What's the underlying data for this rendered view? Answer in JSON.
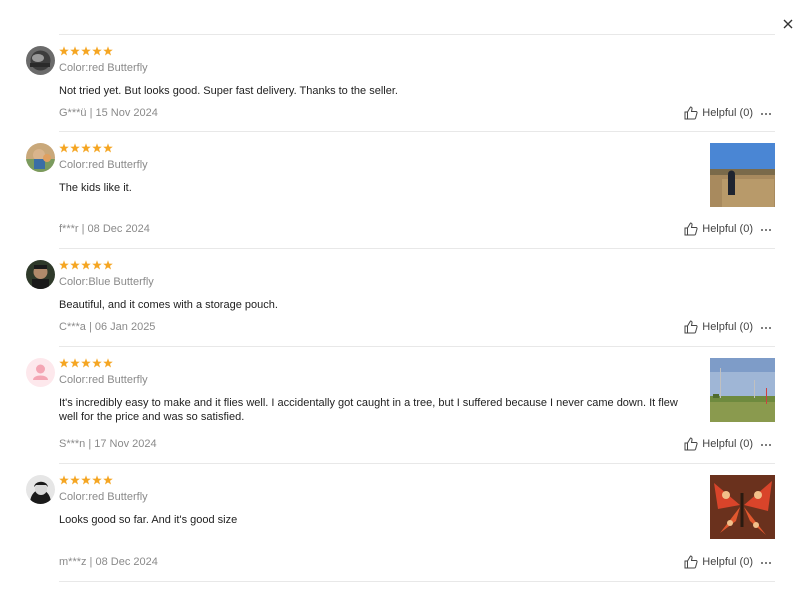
{
  "colors": {
    "star": "#f5a623",
    "divider": "#e8e8e8",
    "muted": "#8a8a8a"
  },
  "icons": {
    "close": "close-icon",
    "helpful": "thumbs-up-icon",
    "more": "ellipsis-icon",
    "star": "star-icon"
  },
  "reviews": [
    {
      "rating": 5,
      "color": "Color:red Butterfly",
      "text": "Not tried yet. But looks good. Super fast delivery. Thanks to the seller.",
      "meta": "G***ü | 15 Nov 2024",
      "helpful": "Helpful (0)"
    },
    {
      "rating": 5,
      "color": "Color:red Butterfly",
      "text": "The kids like it.",
      "meta": "f***r | 08 Dec 2024",
      "helpful": "Helpful (0)"
    },
    {
      "rating": 5,
      "color": "Color:Blue Butterfly",
      "text": "Beautiful, and it comes with a storage pouch.",
      "meta": "C***a | 06 Jan 2025",
      "helpful": "Helpful (0)"
    },
    {
      "rating": 5,
      "color": "Color:red Butterfly",
      "text": "It's incredibly easy to make and it flies well. I accidentally got caught in a tree, but I suffered because I never came down. It flew well for the price and was so satisfied.",
      "meta": "S***n | 17 Nov 2024",
      "helpful": "Helpful (0)"
    },
    {
      "rating": 5,
      "color": "Color:red Butterfly",
      "text": "Looks good so far. And it's good size",
      "meta": "m***z | 08 Dec 2024",
      "helpful": "Helpful (0)"
    }
  ]
}
